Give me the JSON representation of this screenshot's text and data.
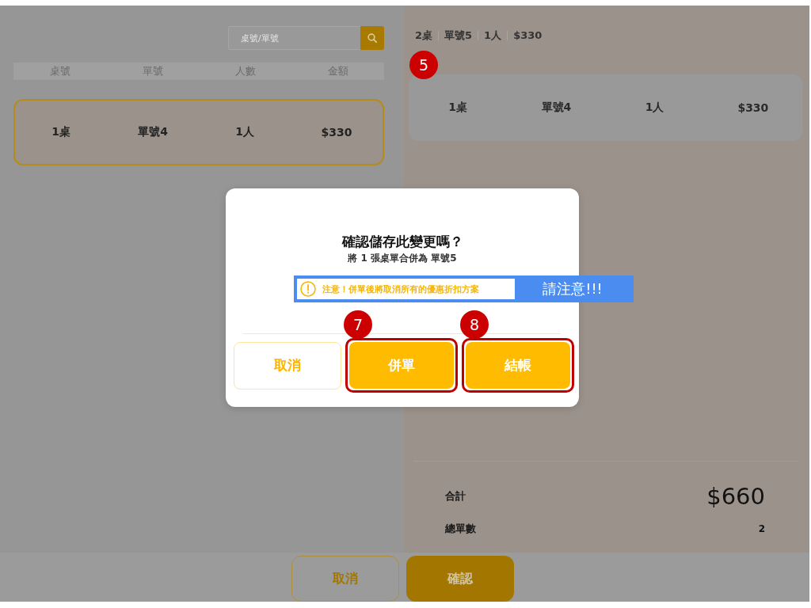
{
  "left_panel": {
    "search": {
      "placeholder": "桌號/單號"
    },
    "table": {
      "columns": [
        "桌號",
        "單號",
        "人數",
        "金額"
      ],
      "rows": [
        {
          "cells": [
            "1桌",
            "單號4",
            "1人",
            "$330"
          ],
          "selected": true
        }
      ]
    }
  },
  "right_panel": {
    "header": [
      "2桌",
      "單號5",
      "1人",
      "$330"
    ],
    "orders": [
      {
        "cells": [
          "1桌",
          "單號4",
          "1人",
          "$330"
        ],
        "badge": "5"
      }
    ],
    "summary": [
      {
        "kind": "total",
        "label": "合計",
        "value": "$660"
      },
      {
        "kind": "count",
        "label": "總單數",
        "value": "2"
      }
    ]
  },
  "bottom_bar": {
    "buttons": [
      {
        "kind": "secondary",
        "label": "取消"
      },
      {
        "kind": "primary",
        "label": "確認"
      }
    ]
  },
  "dialog": {
    "title": "確認儲存此變更嗎？",
    "message": "將 1 張桌單合併為 單號5",
    "warning": {
      "text": "注意！併單後將取消所有的優惠折扣方案",
      "note": "請注意!!!"
    },
    "buttons": [
      {
        "kind": "secondary",
        "label": "取消",
        "highlighted": false
      },
      {
        "kind": "primary",
        "label": "併單",
        "highlighted": true,
        "badge": "7"
      },
      {
        "kind": "primary",
        "label": "結帳",
        "highlighted": true,
        "badge": "8"
      }
    ]
  }
}
